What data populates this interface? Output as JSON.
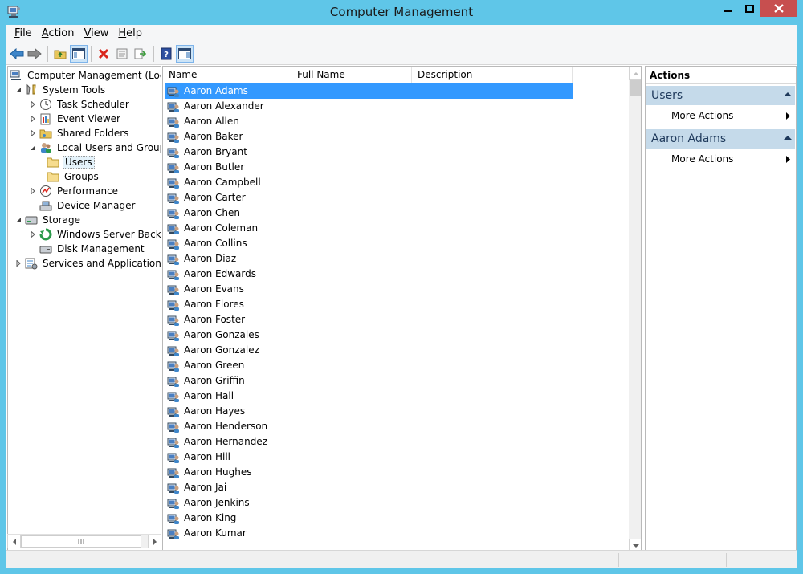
{
  "window": {
    "title": "Computer Management"
  },
  "menu": {
    "file": {
      "acc": "F",
      "rest": "ile"
    },
    "action": {
      "acc": "A",
      "rest": "ction"
    },
    "view": {
      "acc": "V",
      "rest": "iew"
    },
    "help": {
      "acc": "H",
      "rest": "elp"
    }
  },
  "tree": {
    "items": [
      {
        "label": "Computer Management (Local",
        "icon": "computer-management-icon"
      },
      {
        "label": "System Tools",
        "icon": "tools-icon"
      },
      {
        "label": "Task Scheduler",
        "icon": "clock-icon"
      },
      {
        "label": "Event Viewer",
        "icon": "event-viewer-icon"
      },
      {
        "label": "Shared Folders",
        "icon": "shared-folder-icon"
      },
      {
        "label": "Local Users and Groups",
        "icon": "users-group-icon"
      },
      {
        "label": "Users",
        "icon": "folder-icon"
      },
      {
        "label": "Groups",
        "icon": "folder-icon"
      },
      {
        "label": "Performance",
        "icon": "performance-icon"
      },
      {
        "label": "Device Manager",
        "icon": "device-manager-icon"
      },
      {
        "label": "Storage",
        "icon": "storage-icon"
      },
      {
        "label": "Windows Server Backup",
        "icon": "backup-icon"
      },
      {
        "label": "Disk Management",
        "icon": "disk-icon"
      },
      {
        "label": "Services and Applications",
        "icon": "services-icon"
      }
    ]
  },
  "list": {
    "columns": [
      "Name",
      "Full Name",
      "Description"
    ],
    "users": [
      "Aaron Adams",
      "Aaron Alexander",
      "Aaron Allen",
      "Aaron Baker",
      "Aaron Bryant",
      "Aaron Butler",
      "Aaron Campbell",
      "Aaron Carter",
      "Aaron Chen",
      "Aaron Coleman",
      "Aaron Collins",
      "Aaron Diaz",
      "Aaron Edwards",
      "Aaron Evans",
      "Aaron Flores",
      "Aaron Foster",
      "Aaron Gonzales",
      "Aaron Gonzalez",
      "Aaron Green",
      "Aaron Griffin",
      "Aaron Hall",
      "Aaron Hayes",
      "Aaron Henderson",
      "Aaron Hernandez",
      "Aaron Hill",
      "Aaron Hughes",
      "Aaron Jai",
      "Aaron Jenkins",
      "Aaron King",
      "Aaron Kumar"
    ],
    "selected": "Aaron Adams"
  },
  "actions": {
    "header": "Actions",
    "groups": [
      {
        "title": "Users",
        "item": "More Actions"
      },
      {
        "title": "Aaron Adams",
        "item": "More Actions"
      }
    ]
  },
  "colors": {
    "titlebar": "#5fc6e8",
    "selection": "#3399ff",
    "action_group": "#c5daea",
    "close_button": "#c74f4f"
  }
}
